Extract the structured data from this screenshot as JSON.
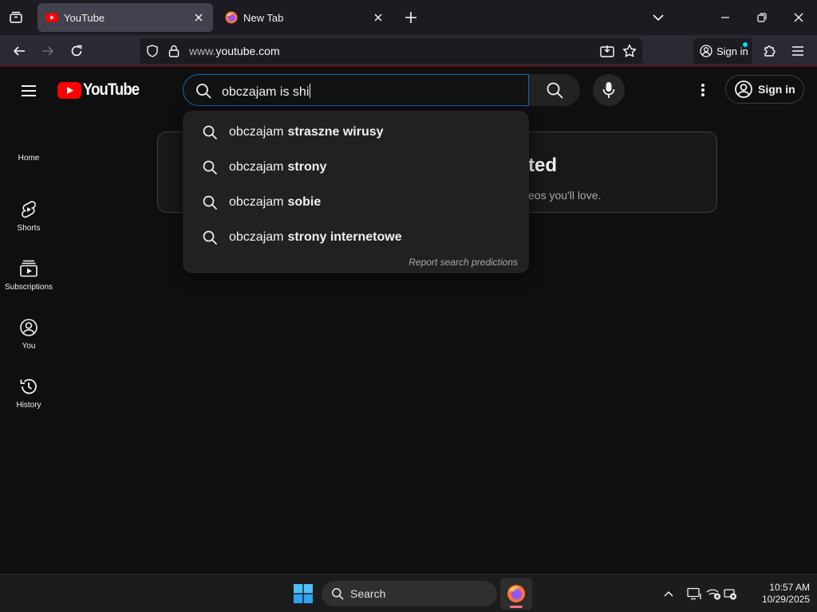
{
  "browser": {
    "tabs": [
      {
        "title": "YouTube",
        "active": true,
        "favicon": "youtube-icon"
      },
      {
        "title": "New Tab",
        "active": false,
        "favicon": "firefox-icon"
      }
    ],
    "url_domain_prefix": "www.",
    "url_domain": "youtube.com",
    "signin_label": "Sign in"
  },
  "youtube": {
    "logo_text": "YouTube",
    "search": {
      "query": "obczajam is shi",
      "suggestions": [
        {
          "typed": "obczajam",
          "completion": "straszne wirusy"
        },
        {
          "typed": "obczajam",
          "completion": "strony"
        },
        {
          "typed": "obczajam",
          "completion": "sobie"
        },
        {
          "typed": "obczajam",
          "completion": "strony internetowe"
        }
      ],
      "report_label": "Report search predictions"
    },
    "signin_label": "Sign in",
    "guide": [
      {
        "label": "Home",
        "icon": "home-icon"
      },
      {
        "label": "Shorts",
        "icon": "shorts-icon"
      },
      {
        "label": "Subscriptions",
        "icon": "subscriptions-icon"
      },
      {
        "label": "You",
        "icon": "you-icon"
      },
      {
        "label": "History",
        "icon": "history-icon"
      }
    ],
    "promo": {
      "title_visible": "ted",
      "subtitle_visible": "eos you'll love."
    }
  },
  "taskbar": {
    "search_label": "Search",
    "time": "10:57 AM",
    "date": "10/29/2025"
  },
  "colors": {
    "youtube_red": "#ff0000",
    "focus_blue": "#1c62b9",
    "background": "#0f0f0f"
  }
}
